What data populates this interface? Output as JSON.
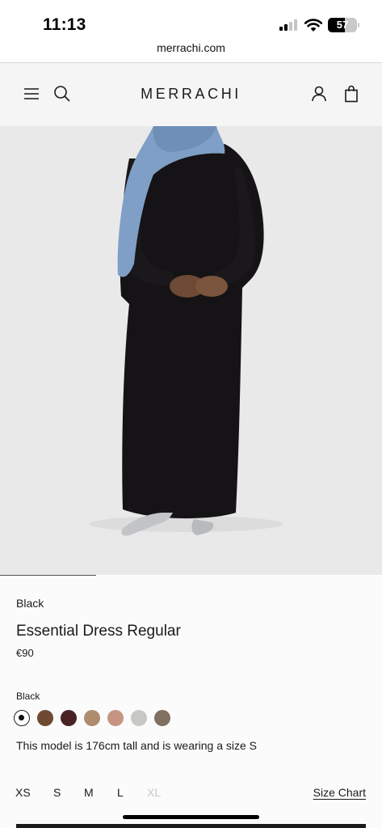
{
  "status_bar": {
    "time": "11:13",
    "battery": "57"
  },
  "browser": {
    "url": "merrachi.com"
  },
  "header": {
    "logo": "MERRACHI",
    "icons": [
      "menu-icon",
      "search-icon",
      "account-icon",
      "bag-icon"
    ]
  },
  "product": {
    "color_label": "Black",
    "title": "Essential Dress Regular",
    "price": "€90",
    "selected_color": "Black",
    "swatches": [
      {
        "name": "black",
        "color": "#111111",
        "selected": true
      },
      {
        "name": "brown",
        "color": "#6f4a33"
      },
      {
        "name": "burgundy",
        "color": "#4a2226"
      },
      {
        "name": "camel",
        "color": "#b08c6e"
      },
      {
        "name": "rose",
        "color": "#c59582"
      },
      {
        "name": "light-grey",
        "color": "#c6c8c4"
      },
      {
        "name": "taupe",
        "color": "#807062"
      }
    ],
    "model_note": "This model is 176cm tall and is wearing a size S",
    "sizes": [
      {
        "label": "XS",
        "available": true
      },
      {
        "label": "S",
        "available": true
      },
      {
        "label": "M",
        "available": true
      },
      {
        "label": "L",
        "available": true
      },
      {
        "label": "XL",
        "available": false
      }
    ],
    "size_chart_label": "Size Chart"
  }
}
